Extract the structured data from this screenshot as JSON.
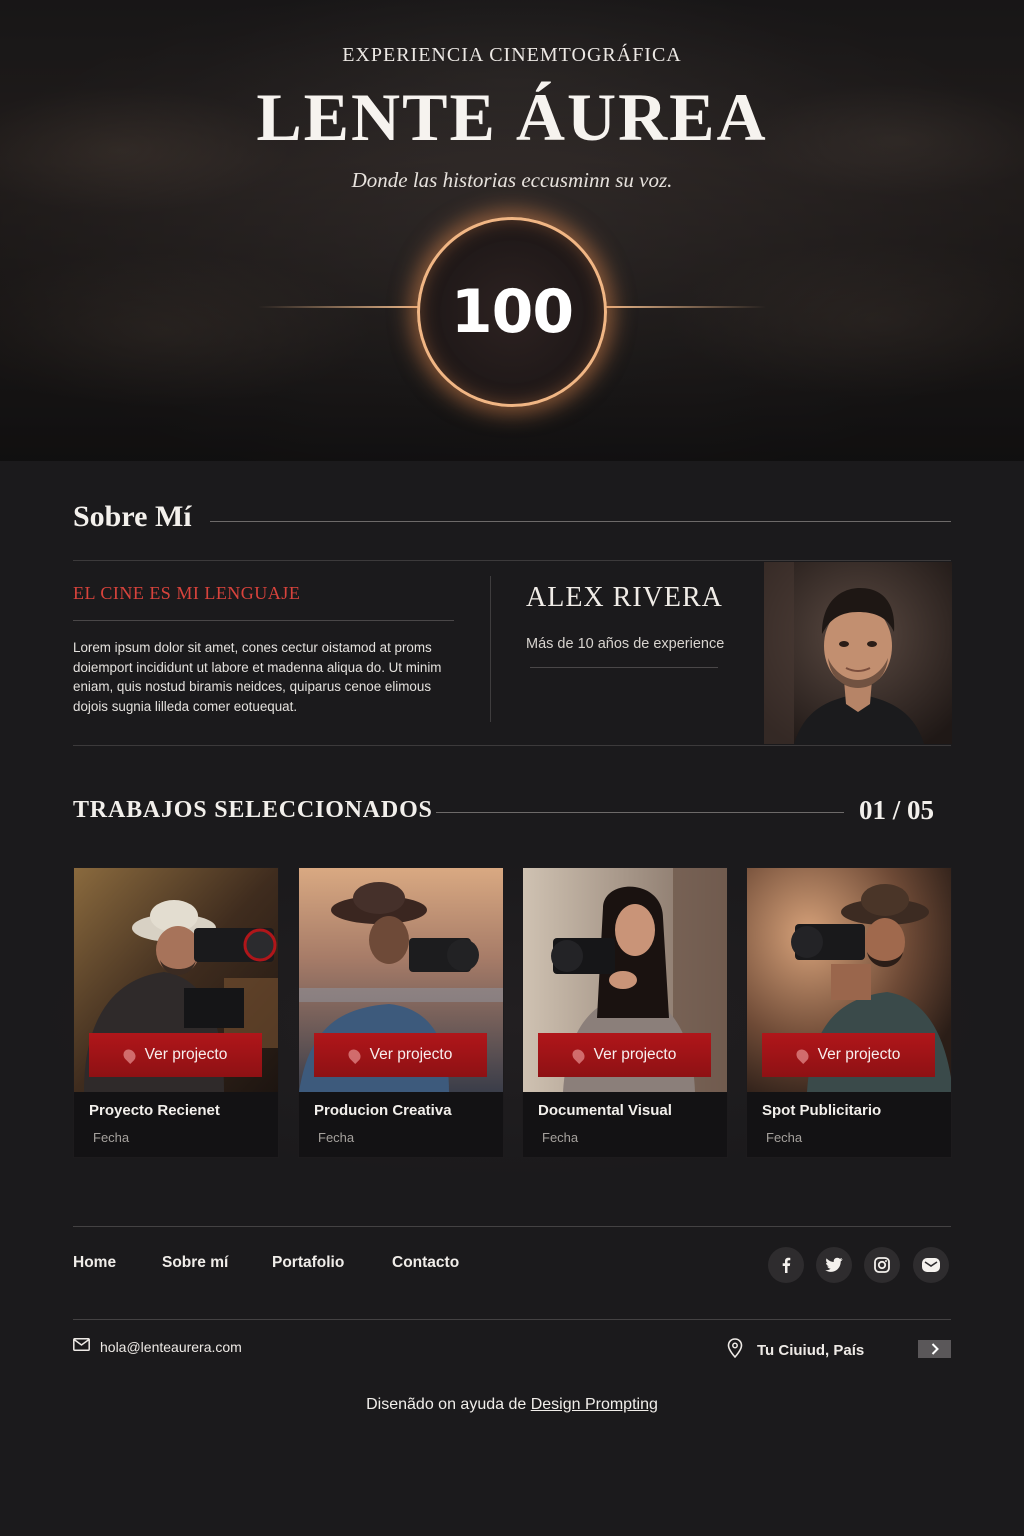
{
  "hero": {
    "eyebrow": "EXPERIENCIA CINEMTOGRÁFICA",
    "title": "LENTE ÁUREA",
    "tagline": "Donde las historias eccusminn su voz.",
    "badge_number": "100"
  },
  "about": {
    "heading": "Sobre Mí",
    "subheading": "EL CINE ES MI LENGUAJE",
    "body": "Lorem ipsum dolor sit amet, cones cectur oistamod at proms doiemport incididunt ut labore et madenna aliqua do. Ut minim eniam, quis nostud biramis neidces, quiparus cenoe elimous dojois sugnia lilleda comer eotuequat.",
    "name": "ALEX RIVERA",
    "experience": "Más de 10 años de experience"
  },
  "works": {
    "heading": "TRABAJOS SELECCIONADOS",
    "counter": "01 / 05",
    "cards": [
      {
        "button_label": "Ver projecto",
        "title": "Proyecto Recienet",
        "date": "Fecha"
      },
      {
        "button_label": "Ver projecto",
        "title": "Producion Creativa",
        "date": "Fecha"
      },
      {
        "button_label": "Ver projecto",
        "title": "Documental Visual",
        "date": "Fecha"
      },
      {
        "button_label": "Ver projecto",
        "title": "Spot Publicitario",
        "date": "Fecha"
      }
    ]
  },
  "footer": {
    "nav": [
      "Home",
      "Sobre mí",
      "Portafolio",
      "Contacto"
    ],
    "social_icons": [
      "facebook-icon",
      "twitter-icon",
      "instagram-icon",
      "mail-icon"
    ],
    "email": "hola@lenteaurera.com",
    "location": "Tu Ciuiud, País",
    "credit_prefix": "Disenãdo on ayuda de",
    "credit_link": "Design Prompting"
  },
  "colors": {
    "accent_red": "#b0161a",
    "subheading_red": "#d8433c",
    "ring_glow": "#f1b684",
    "background": "#1b1a1c"
  }
}
